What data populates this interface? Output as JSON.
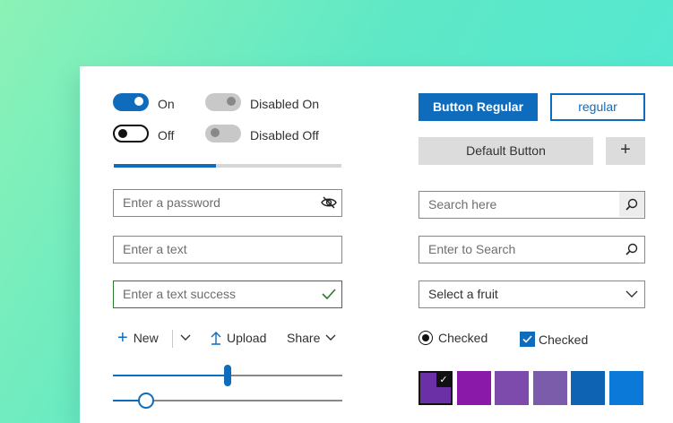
{
  "toggles": {
    "on_label": "On",
    "off_label": "Off",
    "disabled_on_label": "Disabled On",
    "disabled_off_label": "Disabled Off"
  },
  "progress": {
    "value": 0.45
  },
  "fields": {
    "password_placeholder": "Enter a password",
    "text_placeholder": "Enter a text",
    "success_placeholder": "Enter a text success",
    "search_placeholder": "Search here",
    "search2_placeholder": "Enter to Search",
    "select_value": "Select a fruit"
  },
  "buttons": {
    "primary_label": "Button Regular",
    "outline_label": "regular",
    "default_label": "Default Button",
    "plus_label": "+"
  },
  "commandbar": {
    "new_label": "New",
    "upload_label": "Upload",
    "share_label": "Share"
  },
  "sliders": [
    {
      "value": 0.5
    },
    {
      "value": 0.14
    }
  ],
  "radio": {
    "label": "Checked",
    "checked": true
  },
  "checkbox": {
    "label": "Checked",
    "checked": true
  },
  "swatches": [
    {
      "color": "#6b2fa6",
      "selected": true
    },
    {
      "color": "#8a18a8",
      "selected": false
    },
    {
      "color": "#7d4bab",
      "selected": false
    },
    {
      "color": "#7b5caa",
      "selected": false
    },
    {
      "color": "#0f63b3",
      "selected": false
    },
    {
      "color": "#0b79d8",
      "selected": false
    }
  ],
  "colors": {
    "accent": "#0f6cbd",
    "success": "#2d7a2d"
  }
}
